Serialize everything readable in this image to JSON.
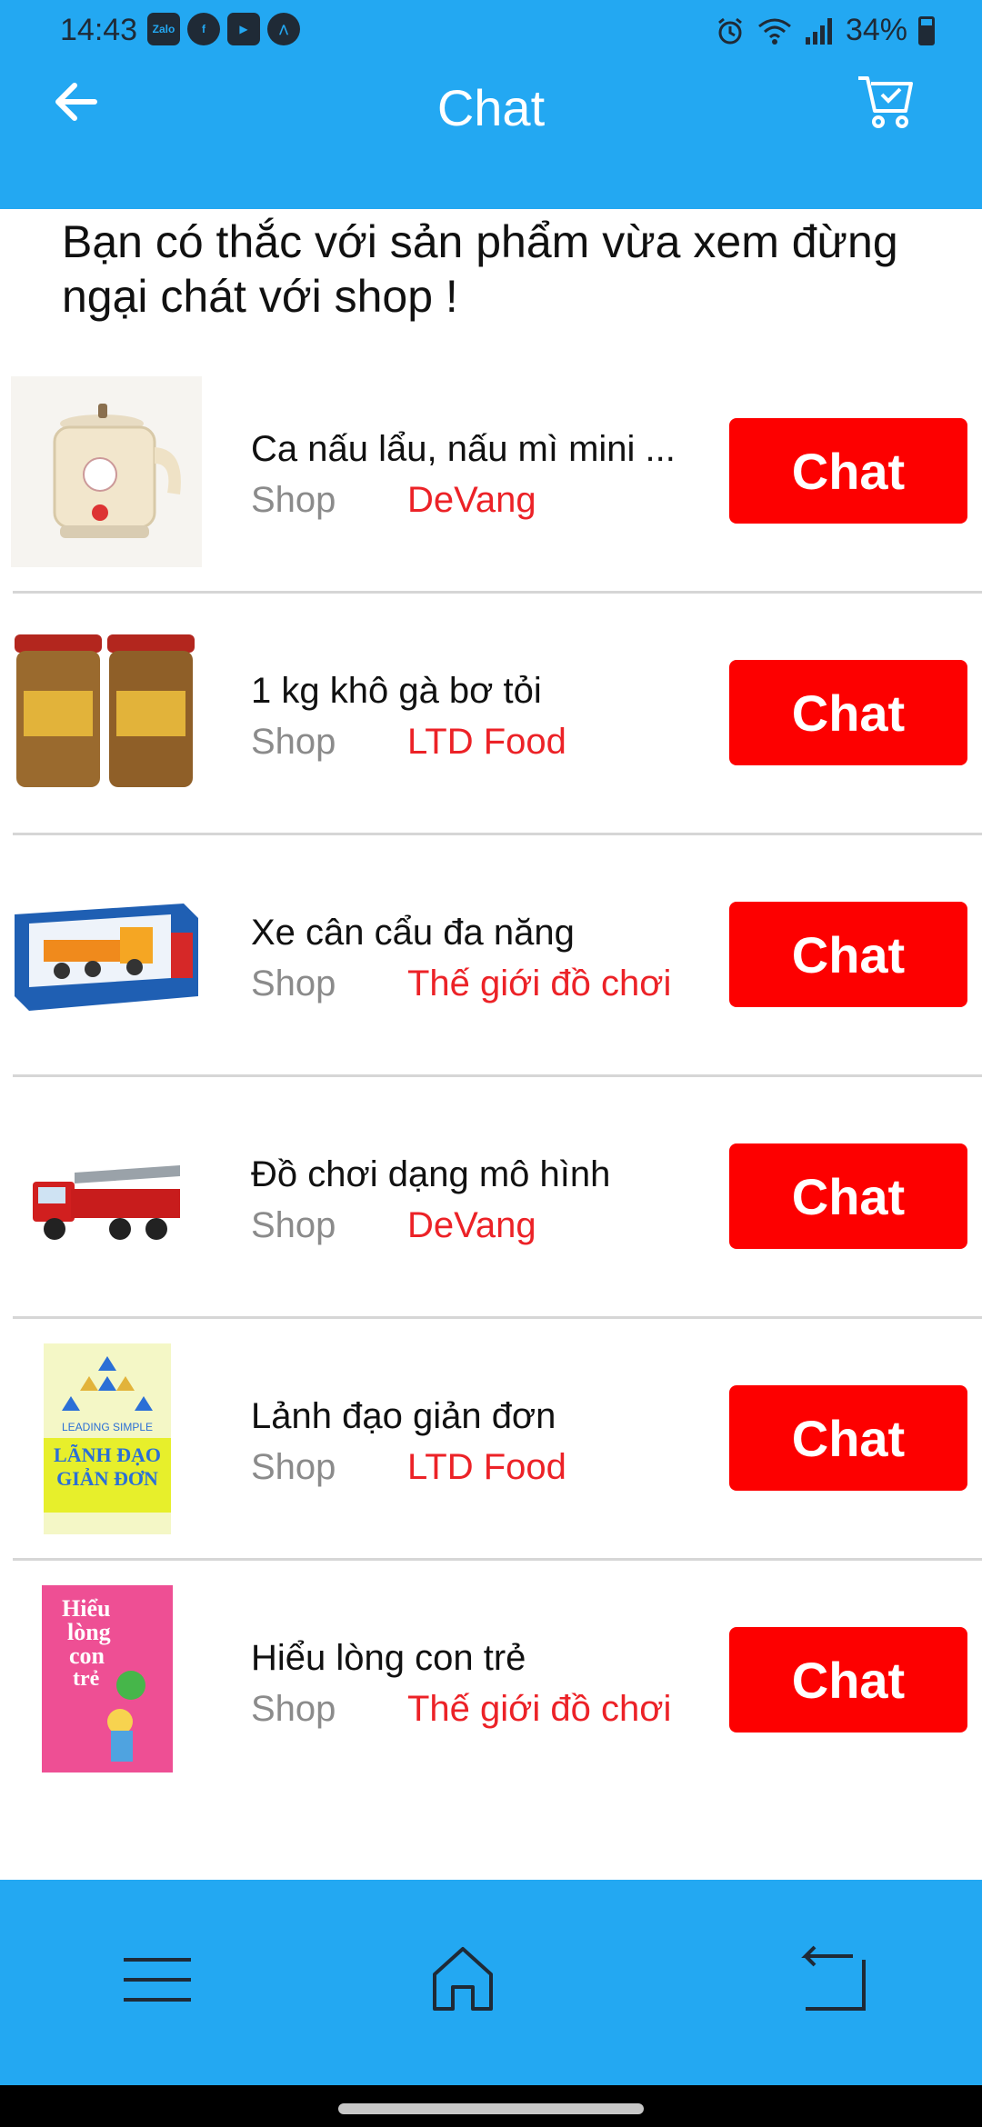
{
  "status_bar": {
    "time": "14:43",
    "apps": [
      {
        "icon": "zalo-icon",
        "label": "Zalo"
      },
      {
        "icon": "facebook-icon",
        "label": "f"
      },
      {
        "icon": "youtube-icon",
        "label": "▶"
      },
      {
        "icon": "arrow-app-icon",
        "label": "⋀"
      }
    ],
    "battery": "34%"
  },
  "header": {
    "title": "Chat",
    "back_icon": "back-arrow-icon",
    "cart_icon": "cart-check-icon"
  },
  "intro": "Bạn có thắc với sản phẩm vừa xem đừng ngại chát với shop !",
  "products": [
    {
      "name": "Ca nấu lẩu, nấu mì mini ...",
      "shop_label": "Shop",
      "shop": "DeVang",
      "chat_label": "Chat",
      "thumb": "hotpot-kettle-image"
    },
    {
      "name": "1 kg khô gà bơ tỏi",
      "shop_label": "Shop",
      "shop": "LTD Food",
      "chat_label": "Chat",
      "thumb": "dried-chicken-jars-image"
    },
    {
      "name": "Xe cân cẩu đa năng",
      "shop_label": "Shop",
      "shop": "Thế giới đồ chơi",
      "chat_label": "Chat",
      "thumb": "crane-truck-box-image"
    },
    {
      "name": "Đồ chơi dạng mô hình",
      "shop_label": "Shop",
      "shop": "DeVang",
      "chat_label": "Chat",
      "thumb": "fire-truck-image"
    },
    {
      "name": "Lảnh đạo giản đơn",
      "shop_label": "Shop",
      "shop": "LTD Food",
      "chat_label": "Chat",
      "thumb": "leading-simple-book-image"
    },
    {
      "name": "Hiểu lòng con trẻ",
      "shop_label": "Shop",
      "shop": "Thế giới đồ chơi",
      "chat_label": "Chat",
      "thumb": "hieu-long-con-tre-book-image"
    }
  ],
  "book_cover_text": {
    "leading_simple": "LEADING SIMPLE",
    "lanh_dao": "LÃNH ĐẠO",
    "gian_don": "GIẢN ĐƠN",
    "hieu": "Hiểu",
    "long": "lòng",
    "con": "con",
    "tre": "trẻ"
  },
  "bottom_nav": [
    {
      "icon": "menu-icon"
    },
    {
      "icon": "home-icon"
    },
    {
      "icon": "return-icon"
    }
  ],
  "colors": {
    "primary": "#23a8f2",
    "chat_button": "#fd0000",
    "shop_name": "#ec2227",
    "muted": "#8b8b8b"
  }
}
